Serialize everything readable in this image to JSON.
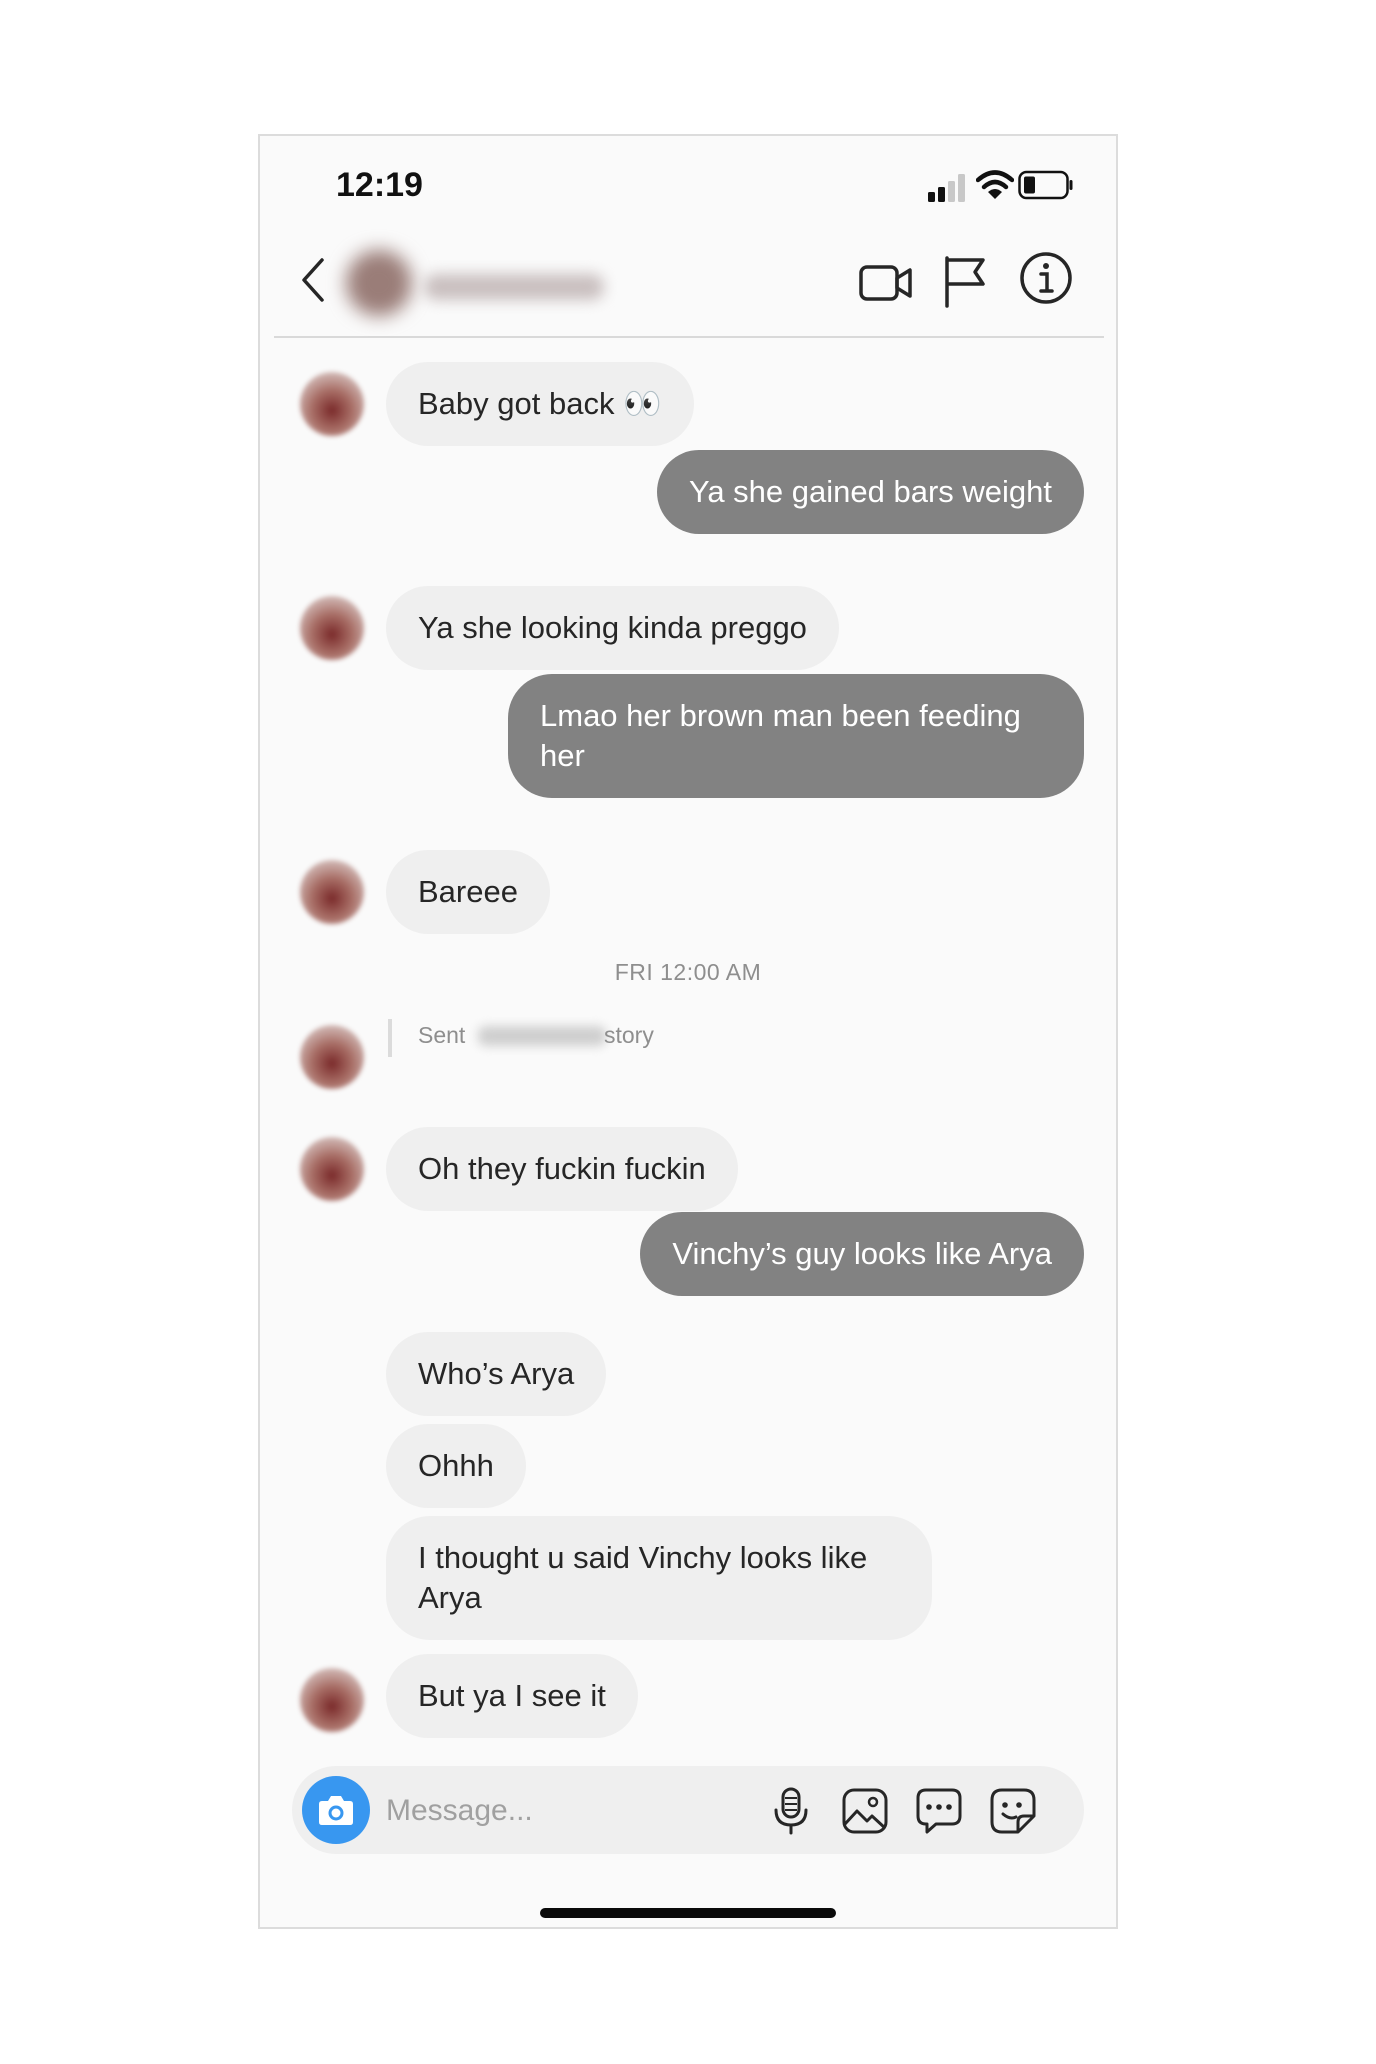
{
  "status_bar": {
    "time": "12:19"
  },
  "conversation": {
    "messages": [
      {
        "direction": "incoming",
        "text": "Baby got back 👀",
        "show_avatar": true
      },
      {
        "direction": "outgoing",
        "text": "Ya she gained bars weight"
      },
      {
        "direction": "incoming",
        "text": "Ya she looking kinda preggo",
        "show_avatar": true
      },
      {
        "direction": "outgoing",
        "text": "Lmao her brown man been feeding her"
      },
      {
        "direction": "incoming",
        "text": "Bareee",
        "show_avatar": true
      },
      {
        "direction": "incoming",
        "text": "Oh they fuckin fuckin",
        "show_avatar": true
      },
      {
        "direction": "outgoing",
        "text": "Vinchy’s guy looks like Arya"
      },
      {
        "direction": "incoming",
        "text": "Who’s Arya",
        "show_avatar": false
      },
      {
        "direction": "incoming",
        "text": "Ohhh",
        "show_avatar": false
      },
      {
        "direction": "incoming",
        "text": "I thought u said Vinchy looks like Arya",
        "show_avatar": false
      },
      {
        "direction": "incoming",
        "text": "But ya I see it",
        "show_avatar": true
      }
    ],
    "timestamp": "FRI 12:00 AM",
    "story_reply": {
      "prefix": "Sent",
      "suffix": "story"
    }
  },
  "composer": {
    "placeholder": "Message..."
  },
  "icons": {
    "back": "chevron-left-icon",
    "video": "video-camera-icon",
    "flag": "flag-icon",
    "info": "info-icon",
    "camera": "camera-icon",
    "mic": "microphone-icon",
    "gallery": "image-icon",
    "chat": "speech-bubble-icon",
    "sticker": "sticker-icon"
  },
  "colors": {
    "incoming_bubble": "#efefef",
    "outgoing_bubble": "#828282",
    "camera_button": "#3897f0",
    "timestamp_text": "#8e8e8e"
  }
}
